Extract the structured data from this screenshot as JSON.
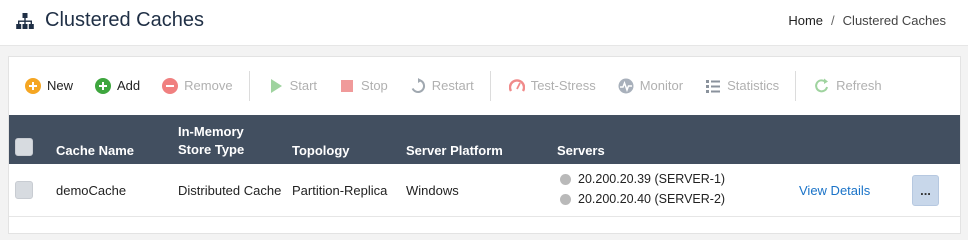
{
  "header": {
    "title": "Clustered Caches",
    "breadcrumb": [
      {
        "label": "Home"
      },
      {
        "label": "Clustered Caches"
      }
    ],
    "separator": "/"
  },
  "toolbar": {
    "buttons": [
      {
        "label": "New",
        "icon": "plus-circle-orange-icon",
        "enabled": true
      },
      {
        "label": "Add",
        "icon": "plus-circle-green-icon",
        "enabled": true
      },
      {
        "label": "Remove",
        "icon": "minus-circle-red-icon",
        "enabled": false
      },
      {
        "label": "Start",
        "icon": "play-icon",
        "enabled": false
      },
      {
        "label": "Stop",
        "icon": "stop-icon",
        "enabled": false
      },
      {
        "label": "Restart",
        "icon": "restart-icon",
        "enabled": false
      },
      {
        "label": "Test-Stress",
        "icon": "gauge-icon",
        "enabled": false
      },
      {
        "label": "Monitor",
        "icon": "pulse-icon",
        "enabled": false
      },
      {
        "label": "Statistics",
        "icon": "list-icon",
        "enabled": false
      },
      {
        "label": "Refresh",
        "icon": "refresh-icon",
        "enabled": false
      }
    ]
  },
  "table": {
    "columns": {
      "cache_name": "Cache Name",
      "store_type_line1": "In-Memory",
      "store_type_line2": "Store Type",
      "topology": "Topology",
      "platform": "Server Platform",
      "servers": "Servers"
    },
    "rows": [
      {
        "cache_name": "demoCache",
        "store_type": "Distributed Cache",
        "topology": "Partition-Replica",
        "platform": "Windows",
        "servers": [
          "20.200.20.39 (SERVER-1)",
          "20.200.20.40 (SERVER-2)"
        ],
        "details_link": "View Details",
        "more_label": "..."
      }
    ]
  },
  "colors": {
    "grid_header": "#424f60",
    "link": "#1a73c8",
    "title": "#1f2f45"
  }
}
